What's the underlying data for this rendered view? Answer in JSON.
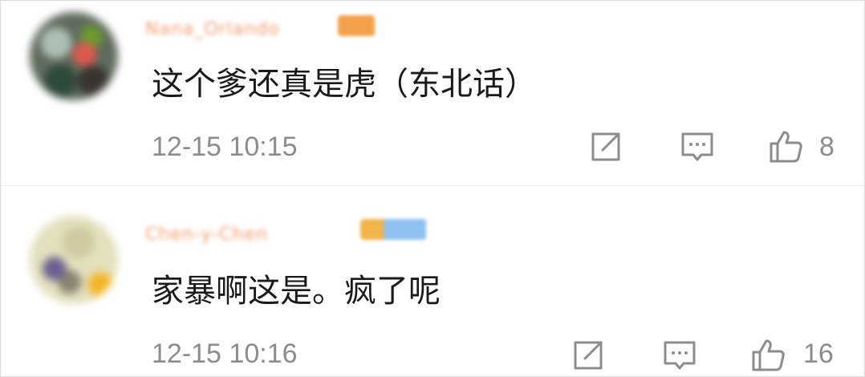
{
  "comments": [
    {
      "username": "Nana_Orlando",
      "text": "这个爹还真是虎（东北话）",
      "timestamp": "12-15 10:15",
      "likes": "8",
      "avatar_colors": [
        "#5f6b5c",
        "#e0584f",
        "#6d9b2e"
      ],
      "badge_color": "#f2a04a"
    },
    {
      "username": "Chen-y-Chen",
      "text": "家暴啊这是。疯了呢",
      "timestamp": "12-15 10:16",
      "likes": "16",
      "avatar_colors": [
        "#e3e0bd",
        "#6b6190",
        "#f3b526"
      ],
      "badge_color": "#8ec0f0"
    }
  ],
  "icons": {
    "share": "share-icon",
    "reply": "comment-icon",
    "like": "thumbs-up-icon"
  },
  "colors": {
    "text": "#1a1a1a",
    "meta": "#8c8c8c",
    "username": "#f09a6b"
  }
}
